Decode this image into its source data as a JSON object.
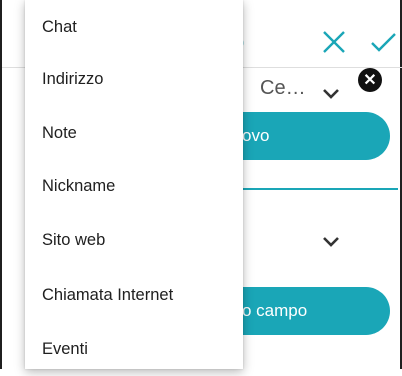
{
  "background": {
    "title_partial": "o",
    "select_value": "Ce…",
    "add_button_label": "ovo",
    "add_field_button_label": "o campo"
  },
  "menu": {
    "items": [
      {
        "label": "Chat"
      },
      {
        "label": "Indirizzo"
      },
      {
        "label": "Note"
      },
      {
        "label": "Nickname"
      },
      {
        "label": "Sito web"
      },
      {
        "label": "Chiamata Internet"
      },
      {
        "label": "Eventi"
      }
    ]
  },
  "icons": {
    "close": "close-icon",
    "confirm": "check-icon",
    "expand": "chevron-down-icon",
    "remove": "remove-icon"
  },
  "colors": {
    "accent": "#1aa6b7",
    "text": "#202020"
  }
}
